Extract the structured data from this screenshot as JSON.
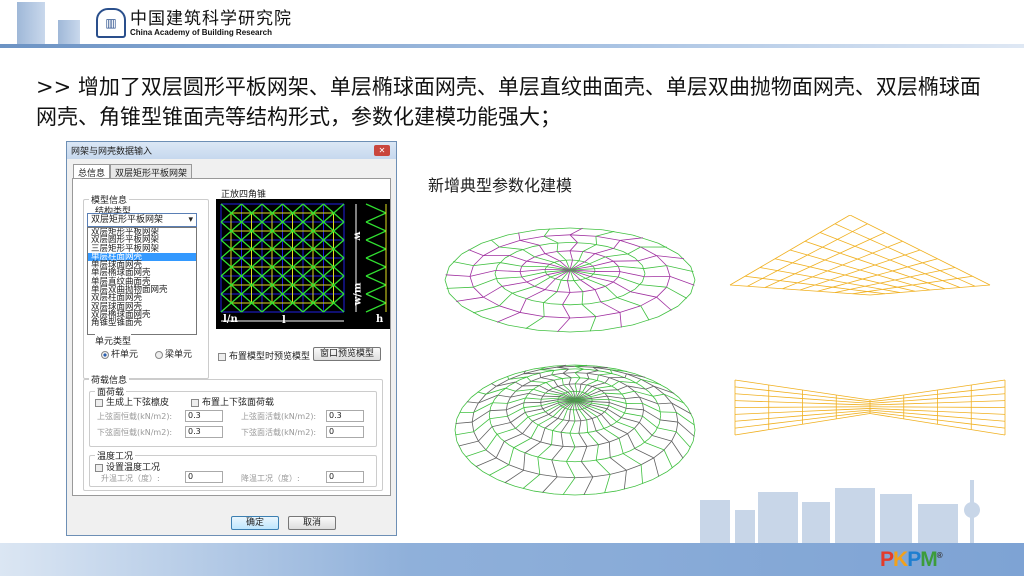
{
  "header": {
    "org_cn": "中国建筑科学研究院",
    "org_en": "China Academy of Building Research"
  },
  "headline": ">> 增加了双层圆形平板网架、单层椭球面网壳、单层直纹曲面壳、单层双曲抛物面网壳、双层椭球面网壳、角锥型锥面壳等结构形式，参数化建模功能强大；",
  "caption": "新增典型参数化建模",
  "dialog": {
    "title": "网架与网壳数据输入",
    "tabs": [
      "总信息",
      "双层矩形平板网架"
    ],
    "model_group": "模型信息",
    "struct_type_label": "结构类型",
    "combo_value": "双层矩形平板网架",
    "options": [
      "双层矩形平板网架",
      "双层圆形平板网架",
      "三层矩形平板网架",
      "单层柱面网壳",
      "单层球面网壳",
      "单层椭球面网壳",
      "单层直纹曲面壳",
      "单层双曲抛物面网壳",
      "双层柱面网壳",
      "双层球面网壳",
      "双层椭球面网壳",
      "角锥型锥面壳"
    ],
    "selected_index": 3,
    "element_type_label": "单元类型",
    "radio_truss": "杆单元",
    "radio_beam": "梁单元",
    "preview_title": "正放四角锥",
    "preview_labels": {
      "l_over_n": "l/n",
      "l": "l",
      "w": "w",
      "w_over_m": "w/m",
      "h": "h"
    },
    "chk_preview": "布置模型时预览模型",
    "btn_window_preview": "窗口预览模型",
    "load_group": "荷载信息",
    "surface_load": "面荷载",
    "chk_purlin": "生成上下弦檩皮",
    "chk_apply_load": "布置上下弦面荷载",
    "upper_dead_label": "上弦面恒载(kN/m2):",
    "upper_dead": "0.3",
    "lower_dead_label": "下弦面恒载(kN/m2):",
    "lower_dead": "0.3",
    "upper_live_label": "上弦面活载(kN/m2):",
    "upper_live": "0.3",
    "lower_live_label": "下弦面活载(kN/m2):",
    "lower_live": "0",
    "temp_group": "温度工况",
    "chk_temp": "设置温度工况",
    "temp_up_label": "升温工况（度）:",
    "temp_up": "0",
    "temp_down_label": "降温工况（度）:",
    "temp_down": "0",
    "ok": "确定",
    "cancel": "取消"
  },
  "footer": {
    "brand": "PKPM",
    "reg": "®"
  }
}
